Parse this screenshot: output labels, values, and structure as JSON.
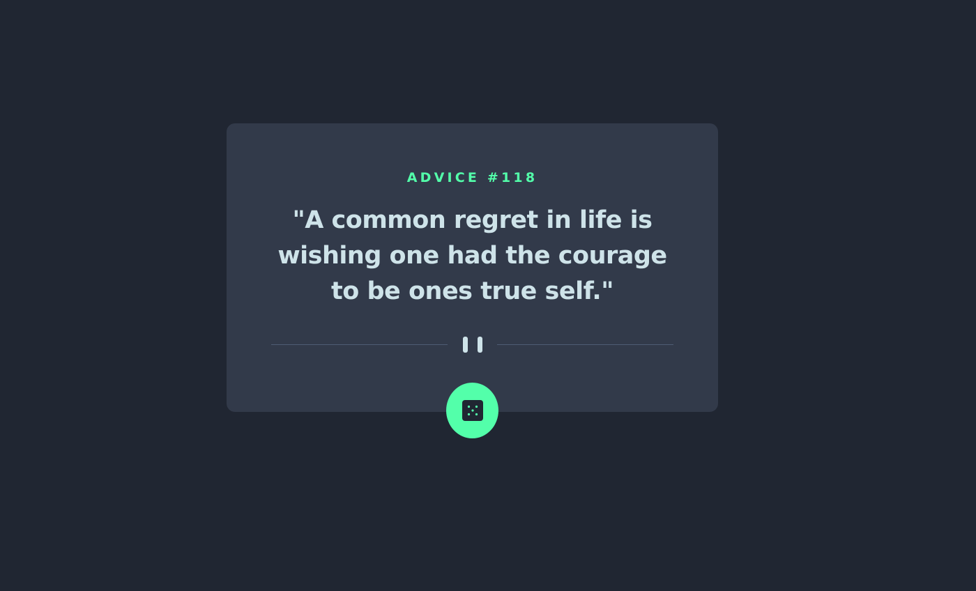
{
  "card": {
    "advice_label": "ADVICE #118",
    "quote": "\"A common regret in life is wishing one had the courage to be ones true self.\""
  },
  "divider": {
    "icon": "pause-icon"
  },
  "dice_button": {
    "icon": "dice-icon"
  },
  "colors": {
    "background": "#202632",
    "card": "#323a4a",
    "accent": "#53ffaa",
    "text": "#cee3e9",
    "divider": "#4f5d74"
  }
}
